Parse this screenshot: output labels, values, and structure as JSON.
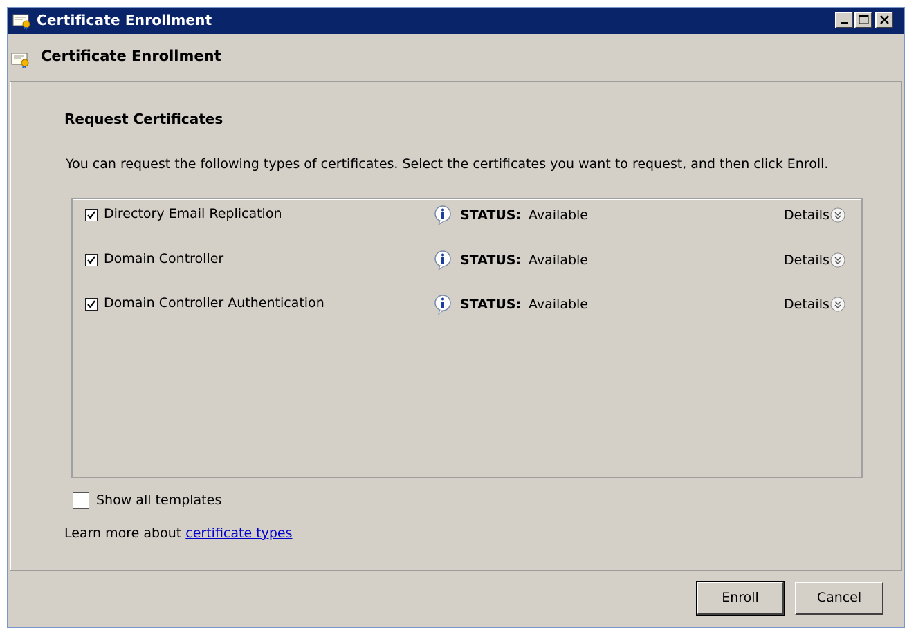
{
  "window": {
    "title": "Certificate Enrollment",
    "controls": {
      "minimize_icon": "minimize-icon",
      "maximize_icon": "maximize-icon",
      "close_icon": "close-icon"
    }
  },
  "header": {
    "title": "Certificate Enrollment",
    "icon": "certificate-icon"
  },
  "page": {
    "section_title": "Request Certificates",
    "instructions": "You can request the following types of certificates. Select the certificates you want to request, and then click Enroll."
  },
  "certificates": [
    {
      "name": "Directory Email Replication",
      "checked": true,
      "status_label": "STATUS:",
      "status_value": "Available",
      "details_label": "Details"
    },
    {
      "name": "Domain Controller",
      "checked": true,
      "status_label": "STATUS:",
      "status_value": "Available",
      "details_label": "Details"
    },
    {
      "name": "Domain Controller Authentication",
      "checked": true,
      "status_label": "STATUS:",
      "status_value": "Available",
      "details_label": "Details"
    }
  ],
  "show_all": {
    "label": "Show all templates",
    "checked": false
  },
  "learn_more": {
    "prefix": "Learn more about ",
    "link": "certificate types"
  },
  "buttons": {
    "enroll": "Enroll",
    "cancel": "Cancel"
  },
  "colors": {
    "titlebar": "#0a246a",
    "window_bg": "#d4d0c8",
    "link": "#0000cc"
  }
}
